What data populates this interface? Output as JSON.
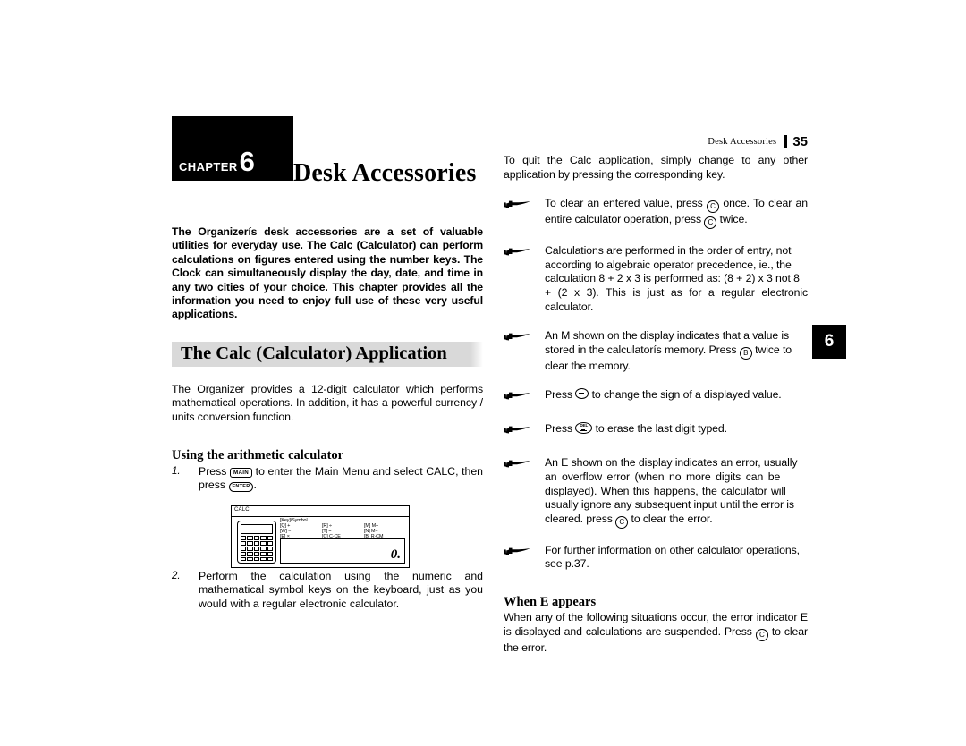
{
  "document": {
    "running_head": {
      "title": "Desk Accessories",
      "page_number": "35"
    },
    "chapter_tab": "6"
  },
  "left_column": {
    "chapter_banner": {
      "word": "CHAPTER",
      "number": "6"
    },
    "chapter_title": "Desk Accessories",
    "intro_paragraph": "The Organizerís desk accessories are a set of valuable utilities for everyday use. The Calc (Calculator) can perform calculations on figures entered using the number keys. The Clock can simultaneously display the day, date, and time in any two cities of your choice. This chapter provides all the information you need to enjoy full use of these very useful applications.",
    "section_heading": "The Calc (Calculator) Application",
    "body_paragraph": "The Organizer provides a 12-digit calculator which performs mathematical operations. In addition, it has a powerful currency / units conversion function.",
    "sub_heading": "Using the arithmetic calculator",
    "steps": [
      {
        "number": "1.",
        "text_before": "Press",
        "key1": "MAIN",
        "text_middle": "to enter the Main Menu and select CALC, then press",
        "key2": "ENTER",
        "text_after": "."
      },
      {
        "number": "2.",
        "text": "Perform the calculation using the numeric and mathematical symbol keys on the keyboard, just as you would with a regular electronic calculator."
      }
    ],
    "illustration": {
      "screen_title": "CALC",
      "key_table_header": "[Key]/Symbol",
      "key_table_rows": [
        [
          "[Q] +",
          "[R] ÷",
          "[M] M+"
        ],
        [
          "[W] −",
          "[T] =",
          "[N] M−"
        ],
        [
          "[E] ×",
          "[C] C·CE",
          "[B] R·CM"
        ]
      ],
      "display_value": "0."
    }
  },
  "right_column": {
    "quit_paragraph": "To quit the Calc application, simply change to any other application by pressing the corresponding key.",
    "bullets": [
      {
        "icon": "pointing-hand-icon",
        "segments": [
          {
            "type": "text",
            "value": "To clear an entered value, press "
          },
          {
            "type": "key",
            "value": "C",
            "style": "circle"
          },
          {
            "type": "text",
            "value": " once. To clear an entire calculator operation, press "
          },
          {
            "type": "key",
            "value": "C",
            "style": "circle"
          },
          {
            "type": "text",
            "value": " twice."
          }
        ],
        "plain": "To clear an entered value, press C once. To clear an entire calculator operation, press C twice."
      },
      {
        "icon": "pointing-hand-icon",
        "plain": "Calculations are performed in the order of entry, not according to algebraic operator precedence, ie., the calculation 8 + 2 x 3 is performed as: (8 + 2) x 3 not 8 + (2 x 3). This is just as for a regular electronic calculator."
      },
      {
        "icon": "pointing-hand-icon",
        "plain": "An M shown on the display indicates that a value is stored in the calculatorís memory. Press B twice to clear the memory."
      },
      {
        "icon": "pointing-hand-icon",
        "plain": "Press ⊖ to change the sign of a displayed value."
      },
      {
        "icon": "pointing-hand-icon",
        "plain": "Press DEL to erase the last digit typed."
      },
      {
        "icon": "pointing-hand-icon",
        "plain": "An E shown on the display indicates an error, usually an overflow error (when no more digits can be displayed). When this happens, the calculator will usually ignore any subsequent input until the error is cleared. press C to clear the error."
      },
      {
        "icon": "pointing-hand-icon",
        "plain": "For further information on other calculator operations, see p.37."
      }
    ],
    "bullet_texts": {
      "b1_a": "To clear an entered value, press",
      "b1_b": "once. To clear an",
      "b1_c": "entire calculator operation, press",
      "b1_d": "twice.",
      "b2_l1": "Calculations are performed in the order of entry, not",
      "b2_l2": "according to algebraic operator precedence, ie., the",
      "b2_l3": "calculation 8 + 2 x 3 is performed as: (8 + 2) x 3 not 8",
      "b2_l4": "+ (2 x 3). This is just as for a regular electronic calculator.",
      "b3_l1": "An M shown on the display indicates that a value is",
      "b3_l2a": "stored in the calculatorís memory. Press",
      "b3_l2b": "twice to",
      "b3_l3": "clear the memory.",
      "b4_a": "Press",
      "b4_b": "to change the sign of a displayed value.",
      "b5_a": "Press",
      "b5_b": "to erase the last digit typed.",
      "b6_l1": "An E shown on the display indicates an error, usually",
      "b6_l2": "an overflow error (when no more digits can be",
      "b6_l3": "displayed). When this happens, the calculator will",
      "b6_l4": "usually ignore any subsequent input until the error is",
      "b6_l5a": "cleared. press",
      "b6_l5b": "to clear the error.",
      "b7_l1": "For further information on other calculator operations,",
      "b7_l2": "see p.37."
    },
    "keys": {
      "clear": "C",
      "memory": "B",
      "del": "DEL"
    },
    "sub_heading": "When E appears",
    "when_e_text": {
      "a": "When any of the following situations occur, the error indicator E is displayed and calculations are suspended. Press",
      "b": "to clear the error."
    }
  },
  "colors": {
    "ink": "#000000",
    "paper": "#ffffff",
    "heading_band": "#d9d9d9"
  }
}
